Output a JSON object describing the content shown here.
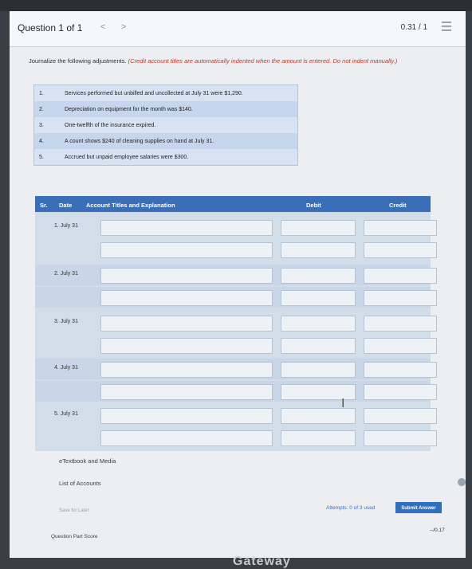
{
  "header": {
    "question_label": "Question 1 of 1",
    "prev_label": "<",
    "next_label": ">",
    "score": "0.31 / 1"
  },
  "instructions": {
    "text": "Journalize the following adjustments.",
    "note": "(Credit account titles are automatically indented when the amount is entered. Do not indent manually.)"
  },
  "adjustments": [
    {
      "num": "1.",
      "text": "Services performed but unbilled and uncollected at July 31 were $1,290."
    },
    {
      "num": "2.",
      "text": "Depreciation on equipment for the month was $140."
    },
    {
      "num": "3.",
      "text": "One-twelfth of the insurance expired."
    },
    {
      "num": "4.",
      "text": "A count shows $240 of cleaning supplies on hand at July 31."
    },
    {
      "num": "5.",
      "text": "Accrued but unpaid employee salaries were $300."
    }
  ],
  "table": {
    "headers": {
      "sr": "Sr.",
      "date": "Date",
      "account": "Account Titles and Explanation",
      "debit": "Debit",
      "credit": "Credit"
    },
    "entries": [
      {
        "label": "1.  July 31"
      },
      {
        "label": "2.  July 31"
      },
      {
        "label": "3.  July 31"
      },
      {
        "label": "4.  July 31"
      },
      {
        "label": "5.  July 31"
      }
    ]
  },
  "links": {
    "textbook": "eTextbook and Media",
    "list_accounts": "List of Accounts",
    "save_later": "Save for Later"
  },
  "footer": {
    "attempts": "Attempts: 0 of 3 used",
    "submit": "Submit Answer",
    "part_score_label": "Question Part Score",
    "part_score_value": "--/0.17",
    "watermark": "Gateway"
  }
}
